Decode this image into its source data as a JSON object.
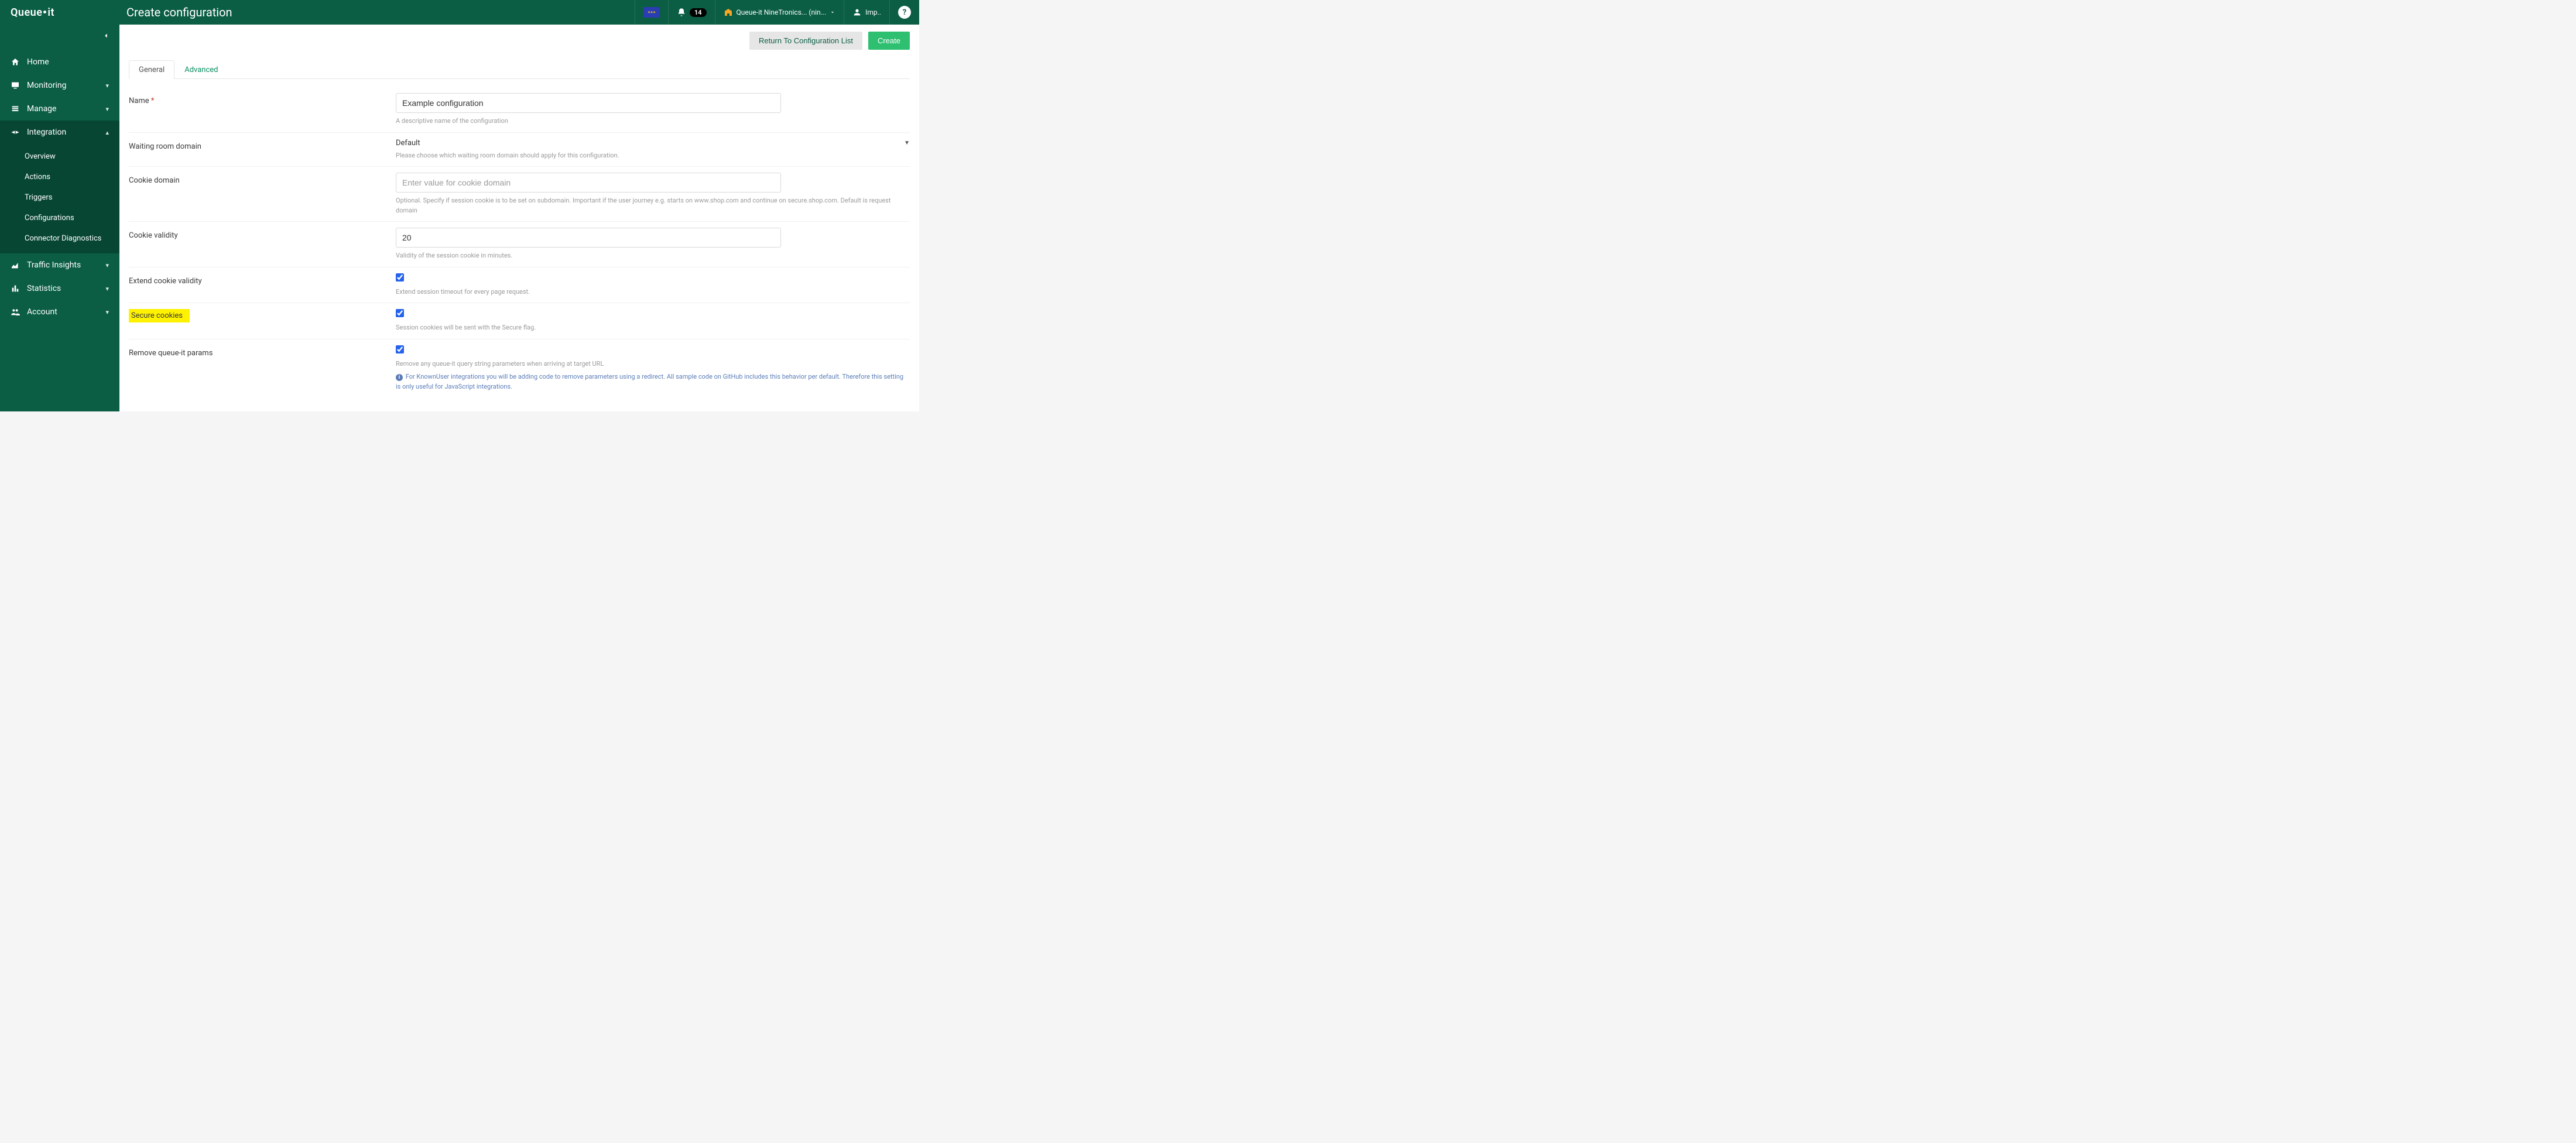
{
  "brand": "Queue·it",
  "page_title": "Create configuration",
  "header": {
    "notifications_count": "14",
    "account_label": "Queue-it NineTronics... (nin...",
    "user_label": "Imp..",
    "help_glyph": "?"
  },
  "sidebar": {
    "home": "Home",
    "monitoring": "Monitoring",
    "manage": "Manage",
    "integration": "Integration",
    "integration_items": {
      "overview": "Overview",
      "actions": "Actions",
      "triggers": "Triggers",
      "configurations": "Configurations",
      "connector_diag": "Connector Diagnostics"
    },
    "traffic_insights": "Traffic Insights",
    "statistics": "Statistics",
    "account": "Account"
  },
  "actions": {
    "return_list": "Return To Configuration List",
    "create": "Create"
  },
  "tabs": {
    "general": "General",
    "advanced": "Advanced"
  },
  "form": {
    "name": {
      "label": "Name",
      "value": "Example configuration",
      "help": "A descriptive name of the configuration"
    },
    "waiting_room_domain": {
      "label": "Waiting room domain",
      "value": "Default",
      "help": "Please choose which waiting room domain should apply for this configuration."
    },
    "cookie_domain": {
      "label": "Cookie domain",
      "placeholder": "Enter value for cookie domain",
      "help": "Optional. Specify if session cookie is to be set on subdomain. Important if the user journey e.g. starts on www.shop.com and continue on secure.shop.com. Default is request domain"
    },
    "cookie_validity": {
      "label": "Cookie validity",
      "value": "20",
      "help": "Validity of the session cookie in minutes."
    },
    "extend_cookie": {
      "label": "Extend cookie validity",
      "checked": true,
      "help": "Extend session timeout for every page request."
    },
    "secure_cookies": {
      "label": "Secure cookies",
      "checked": true,
      "help": "Session cookies will be sent with the Secure flag."
    },
    "remove_params": {
      "label": "Remove queue-it params",
      "checked": true,
      "help1": "Remove any queue-it query string parameters when arriving at target URL",
      "help2": "For KnownUser integrations you will be adding code to remove parameters using a redirect. All sample code on GitHub includes this behavior per default. Therefore this setting is only useful for JavaScript integrations."
    }
  }
}
